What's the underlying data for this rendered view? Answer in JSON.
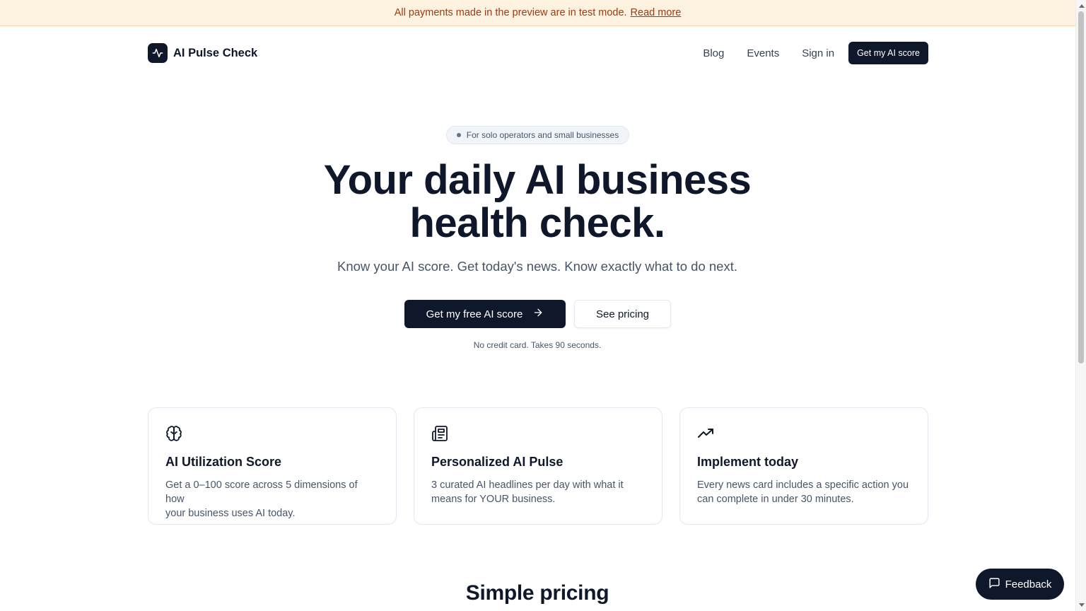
{
  "banner": {
    "message": "All payments made in the preview are in test mode.",
    "link": "Read more"
  },
  "nav": {
    "brand": "AI Pulse Check",
    "links": [
      "Blog",
      "Events",
      "Sign in"
    ],
    "cta": "Get my AI score"
  },
  "hero": {
    "pill": "For solo operators and small businesses",
    "title_line1": "Your daily AI business",
    "title_line2": "health check.",
    "subtitle": "Know your AI score. Get today's news. Know exactly what to do next.",
    "primary_cta": "Get my free AI score",
    "secondary_cta": "See pricing",
    "note": "No credit card. Takes 90 seconds."
  },
  "features": [
    {
      "icon": "brain-icon",
      "title": "AI Utilization Score",
      "desc_line1": "Get a 0–100 score across 5 dimensions of how",
      "desc_line2": "your business uses AI today."
    },
    {
      "icon": "newspaper-icon",
      "title": "Personalized AI Pulse",
      "desc_line1": "3 curated AI headlines per day with what it",
      "desc_line2": "means for YOUR business."
    },
    {
      "icon": "trending-up-icon",
      "title": "Implement today",
      "desc_line1": "Every news card includes a specific action you",
      "desc_line2": "can complete in under 30 minutes."
    }
  ],
  "pricing": {
    "title": "Simple pricing"
  },
  "feedback": {
    "label": "Feedback"
  },
  "colors": {
    "primary": "#0f172a",
    "banner_bg": "#fdf1e0",
    "banner_text": "#9a3b12",
    "muted_text": "#475569"
  }
}
